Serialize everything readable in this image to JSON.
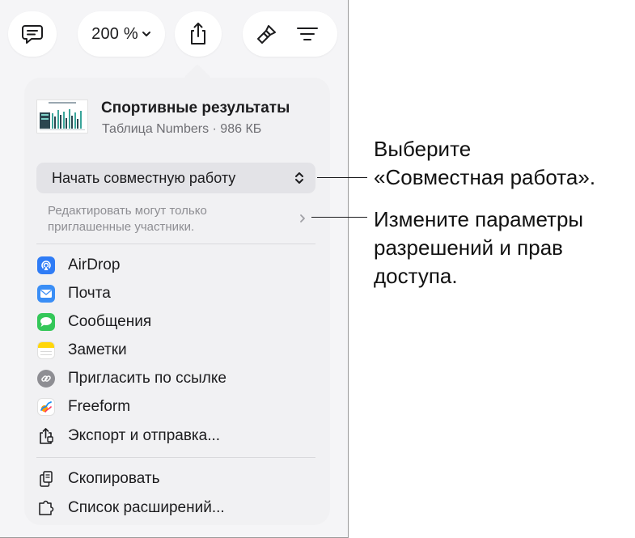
{
  "toolbar": {
    "comment_icon": "speech-bubble-icon",
    "zoom_label": "200 %",
    "share_icon": "share-icon",
    "format_icon": "paintbrush-icon",
    "organize_icon": "filter-lines-icon"
  },
  "document": {
    "title": "Спортивные результаты",
    "subtitle": "Таблица Numbers · 986 КБ"
  },
  "collaboration": {
    "label": "Начать совместную работу",
    "permissions_text": "Редактировать могут только приглашенные участники."
  },
  "share_items": [
    {
      "label": "AirDrop",
      "icon": "airdrop-icon"
    },
    {
      "label": "Почта",
      "icon": "mail-icon"
    },
    {
      "label": "Сообщения",
      "icon": "messages-icon"
    },
    {
      "label": "Заметки",
      "icon": "notes-icon"
    },
    {
      "label": "Пригласить по ссылке",
      "icon": "link-icon"
    },
    {
      "label": "Freeform",
      "icon": "freeform-icon"
    },
    {
      "label": "Экспорт и отправка...",
      "icon": "export-icon"
    }
  ],
  "bottom_items": [
    {
      "label": "Скопировать",
      "icon": "copy-icon"
    },
    {
      "label": "Список расширений...",
      "icon": "extensions-icon"
    }
  ],
  "callouts": {
    "collab_line1": "Выберите",
    "collab_line2": "«Совместная работа».",
    "perm_line1": "Измените параметры",
    "perm_line2": "разрешений и прав",
    "perm_line3": "доступа."
  },
  "colors": {
    "airdrop": "#2f7cf6",
    "mail": "#3a8ef6",
    "messages": "#34c759",
    "notes": "#ffd60a",
    "link": "#8e8e93"
  }
}
